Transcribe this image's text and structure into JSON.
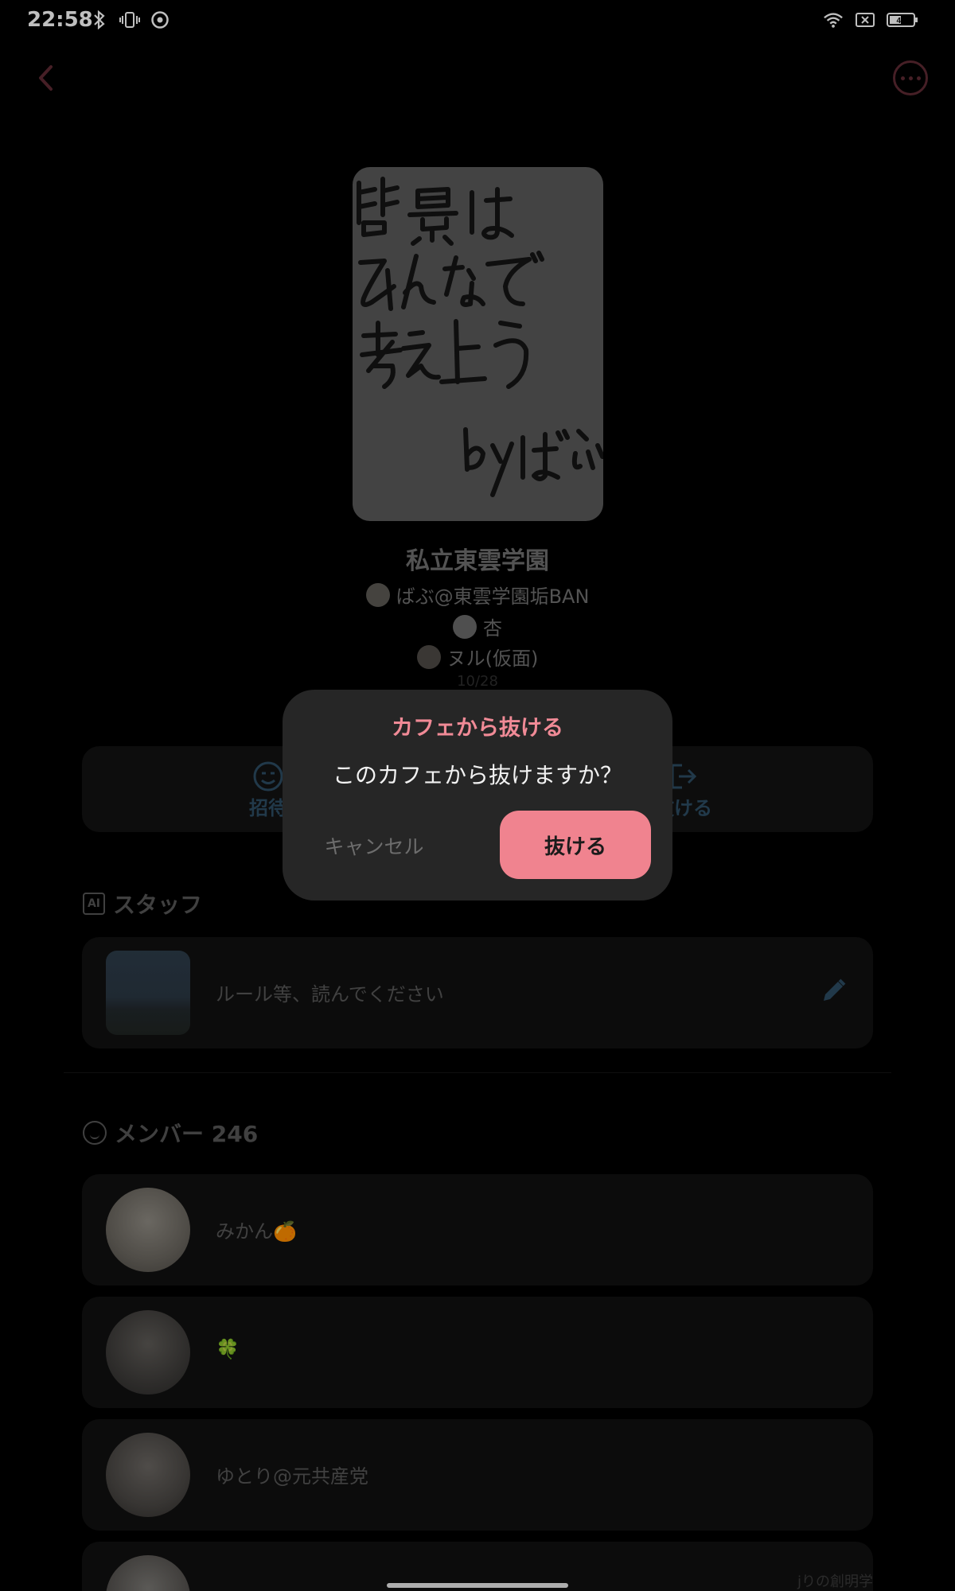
{
  "status_bar": {
    "time": "22:58",
    "battery": "41",
    "left_icons": [
      "bluetooth-icon",
      "vibrate-icon",
      "chrome-icon"
    ],
    "right_icons": [
      "wifi-icon",
      "sim-off-icon",
      "battery-icon"
    ]
  },
  "header": {
    "back_icon": "chevron-left-icon",
    "more_icon": "more-options-icon"
  },
  "cafe": {
    "cover_text": [
      "背景は",
      "みんなで",
      "考え上う",
      "byばぶ"
    ],
    "title": "私立東雲学園",
    "admins": [
      "ばぶ@東雲学園垢BAN",
      "杏",
      "ヌル(仮面)"
    ],
    "date": "10/28"
  },
  "actions": {
    "invite_label": "招待",
    "leave_label": "抜ける"
  },
  "staff_section": {
    "title": "スタッフ",
    "badge": "AI",
    "card_text": "ルール等、読んでください"
  },
  "members_section": {
    "title": "メンバー 246",
    "members": [
      {
        "name": "みかん🍊"
      },
      {
        "name": "🍀"
      },
      {
        "name": "ゆとり@元共産党"
      },
      {
        "name": "",
        "extra": "jりの創明学"
      }
    ]
  },
  "dialog": {
    "title": "カフェから抜ける",
    "message": "このカフェから抜けますか？",
    "cancel": "キャンセル",
    "confirm": "抜ける"
  },
  "colors": {
    "accent": "#f0838f",
    "dialog_bg": "#262626",
    "background": "#000000"
  }
}
